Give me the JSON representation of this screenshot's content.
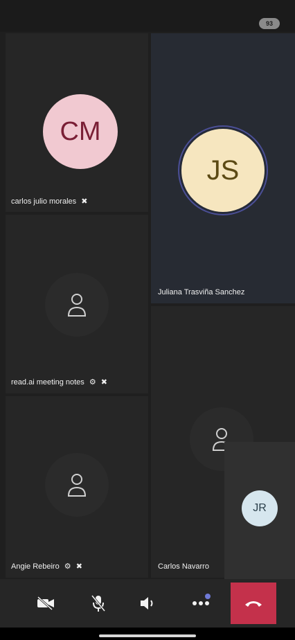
{
  "status_bar": {
    "battery": "93"
  },
  "participants": [
    {
      "name": "carlos julio morales",
      "initials": "CM",
      "status_icons": [
        "mic-off-icon"
      ]
    },
    {
      "name": "Juliana Trasviña Sanchez",
      "initials": "JS",
      "speaking": true
    },
    {
      "name": "read.ai meeting notes",
      "status_icons": [
        "bot-icon",
        "mic-off-icon"
      ]
    },
    {
      "name": "Angie Rebeiro",
      "status_icons": [
        "bot-icon",
        "mic-off-icon"
      ]
    },
    {
      "name": "Carlos Navarro"
    }
  ],
  "self_view": {
    "initials": "JR"
  },
  "controls": {
    "camera": "camera-off-icon",
    "mic": "mic-off-icon",
    "speaker": "speaker-icon",
    "more": "more-icon",
    "hangup": "hang-up-icon",
    "accent": "#6f7ad7",
    "hangup_color": "#c4314b"
  },
  "status_glyphs": {
    "mic_off": "🎙̸",
    "bot": "⚙"
  }
}
